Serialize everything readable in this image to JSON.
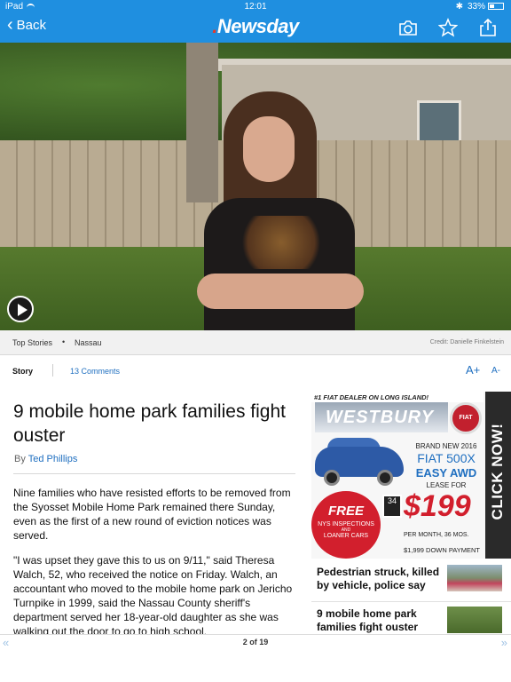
{
  "status": {
    "device": "iPad",
    "time": "12:01",
    "battery": "33%",
    "battery_level": 0.33
  },
  "nav": {
    "back_label": "Back",
    "logo": "Newsday",
    "logo_prefix": "."
  },
  "breadcrumb": {
    "section": "Top Stories",
    "separator": "•",
    "subsection": "Nassau",
    "credit": "Credit: Danielle Finkelstein"
  },
  "tabs": {
    "story": "Story",
    "comments": "13 Comments",
    "font_up": "A+",
    "font_down": "A-"
  },
  "article": {
    "headline": "9 mobile home park families fight ouster",
    "byline_prefix": "By",
    "author": "Ted Phillips",
    "paragraphs": [
      "Nine families who have resisted efforts to be removed from the Syosset Mobile Home Park remained there Sunday, even as the first of a new round of eviction notices was served.",
      "\"I was upset they gave this to us on 9/11,\" said Theresa Walch, 52, who received the notice on Friday. Walch, an accountant who moved to the mobile home park on Jericho Turnpike in 1999, said the Nassau County sheriff's department served her 18-year-old daughter as she was walking out the door to go to high school."
    ]
  },
  "ad": {
    "top_line": "#1 FIAT DEALER ON LONG ISLAND!",
    "dealer": "WESTBURY",
    "badge": "FIAT",
    "line1": "BRAND NEW 2016",
    "line2": "FIAT 500X",
    "line3": "EASY AWD",
    "line4": "LEASE FOR",
    "free": "FREE",
    "free_line1": "NYS INSPECTIONS",
    "free_line2": "AND",
    "free_line3": "LOANER CARS",
    "mpg": "34",
    "price": "$199",
    "per_month": "PER MONTH, 36 MOS.",
    "down_payment": "$1,999 DOWN PAYMENT",
    "cta": "CLICK NOW!"
  },
  "related": [
    {
      "title": "Pedestrian struck, killed by vehicle, police say"
    },
    {
      "title": "9 mobile home park families fight ouster"
    }
  ],
  "pagination": {
    "label": "2 of 19",
    "prev": "«",
    "next": "»"
  }
}
